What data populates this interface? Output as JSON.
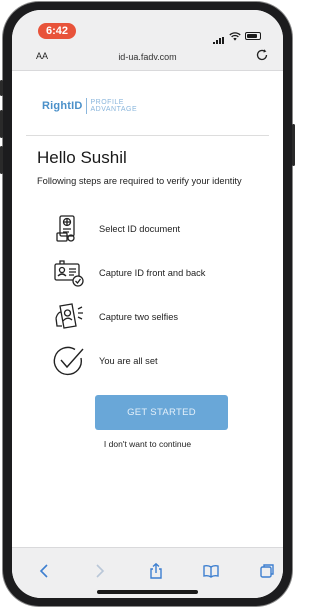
{
  "status_bar": {
    "time": "6:42"
  },
  "browser": {
    "text_size_label": "AA",
    "url": "id-ua.fadv.com"
  },
  "brand": {
    "name": "RightID",
    "tag_line1": "PROFILE",
    "tag_line2": "ADVANTAGE"
  },
  "page": {
    "greeting": "Hello Sushil",
    "subtitle": "Following steps are required to verify your identity",
    "steps": [
      {
        "label": "Select ID document",
        "icon": "id-document-icon"
      },
      {
        "label": "Capture ID front and back",
        "icon": "id-card-capture-icon"
      },
      {
        "label": "Capture two selfies",
        "icon": "selfie-phone-icon"
      },
      {
        "label": "You are all set",
        "icon": "checkmark-circle-icon"
      }
    ],
    "cta_label": "GET STARTED",
    "decline_label": "I don't want to continue"
  },
  "colors": {
    "brand": "#4a90c9",
    "button": "#69a7d8",
    "time_pill": "#e8533a"
  }
}
